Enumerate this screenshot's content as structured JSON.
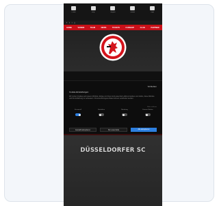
{
  "topbar": {
    "items": [
      {
        "icon": "ticket-icon",
        "label": "Tickets"
      },
      {
        "icon": "shop-icon",
        "label": "Shop"
      },
      {
        "icon": "member-icon",
        "label": "Mitglied"
      },
      {
        "icon": "stadium-icon",
        "label": "Stadion"
      },
      {
        "icon": "login-icon",
        "label": "Login"
      }
    ]
  },
  "infostrip": {
    "items": [
      "f",
      "t",
      "i",
      "y"
    ]
  },
  "nav": {
    "items": [
      "HOME",
      "VEREIN",
      "TEAM",
      "NEWS",
      "TICKETS",
      "FANSHOP",
      "CLUB",
      "PARTNER"
    ]
  },
  "cookie": {
    "title": "Cookie-Einstellungen",
    "close": "Schließen",
    "text": "Wir nutzen Cookies auf unserer Website. Einige von ihnen sind essenziell, während andere uns helfen, diese Website und Ihre Erfahrung zu verbessern. Personenbezogene Daten können verarbeitet werden.",
    "more": "Mehr erfahren",
    "categories": [
      {
        "label": "Essenziell",
        "on": true
      },
      {
        "label": "Statistiken",
        "on": false
      },
      {
        "label": "Marketing",
        "on": false
      },
      {
        "label": "Externe Medien",
        "on": false
      }
    ],
    "buttons": {
      "accept_selection": "Auswahl akzeptieren",
      "essential_only": "Nur essenzielle",
      "accept_all": "Alle akzeptieren"
    }
  },
  "hero": {
    "title": "DÜSSELDORFER SC"
  },
  "colors": {
    "brand_red": "#c8101a",
    "accent_blue": "#2d7fe0",
    "background_dark": "#101010"
  }
}
